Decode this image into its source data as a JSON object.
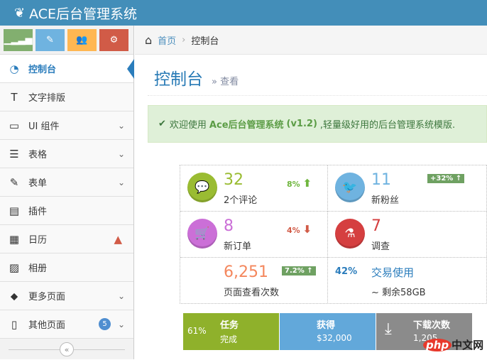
{
  "header": {
    "title": "ACE后台管理系统",
    "logo_icon": "leaf-icon"
  },
  "shortcuts": [
    {
      "icon": "signal-icon",
      "color": "#82af6f"
    },
    {
      "icon": "pencil-icon",
      "color": "#6fb3e0"
    },
    {
      "icon": "users-icon",
      "color": "#ffb752"
    },
    {
      "icon": "cogs-icon",
      "color": "#d15b47"
    }
  ],
  "sidebar": {
    "items": [
      {
        "label": "控制台",
        "icon": "dashboard-icon",
        "active": true
      },
      {
        "label": "文字排版",
        "icon": "text-icon"
      },
      {
        "label": "UI 组件",
        "icon": "desktop-icon",
        "chevron": true
      },
      {
        "label": "表格",
        "icon": "list-icon",
        "chevron": true
      },
      {
        "label": "表单",
        "icon": "edit-icon",
        "chevron": true
      },
      {
        "label": "插件",
        "icon": "list-alt-icon"
      },
      {
        "label": "日历",
        "icon": "calendar-icon",
        "warning": true
      },
      {
        "label": "相册",
        "icon": "picture-icon"
      },
      {
        "label": "更多页面",
        "icon": "tag-icon",
        "chevron": true
      },
      {
        "label": "其他页面",
        "icon": "file-icon",
        "chevron": true,
        "badge": "5"
      }
    ]
  },
  "breadcrumb": {
    "home": "首页",
    "current": "控制台"
  },
  "page": {
    "title": "控制台",
    "subtitle": "查看"
  },
  "alert": {
    "prefix": "欢迎使用",
    "brand": "Ace后台管理系统",
    "version": "(v1.2)",
    "suffix": ",轻量级好用的后台管理系统模版."
  },
  "stats": [
    {
      "value": "32",
      "label": "2个评论",
      "change": "8%",
      "dir": "up",
      "color": "#9abc32"
    },
    {
      "value": "11",
      "label": "新粉丝",
      "change": "+32%",
      "color": "#6fb3e0"
    },
    {
      "value": "8",
      "label": "新订单",
      "change": "4%",
      "dir": "down",
      "color": "#cb6fd7"
    },
    {
      "value": "7",
      "label": "调查",
      "color": "#d53f40"
    },
    {
      "value": "6,251",
      "label": "页面查看次数",
      "change": "7.2%",
      "color": "#f4875d"
    },
    {
      "percent": "42%",
      "title": "交易使用",
      "label": "~ 剩余58GB"
    }
  ],
  "bottom": [
    {
      "percent": "61%",
      "title": "任务",
      "sub": "完成",
      "color": "#8fb12b"
    },
    {
      "title": "获得",
      "sub": "$32,000",
      "color": "#62a8da"
    },
    {
      "title": "下载次数",
      "sub": "1,205",
      "color": "#8b8b8b"
    }
  ],
  "watermark": "php中文网"
}
